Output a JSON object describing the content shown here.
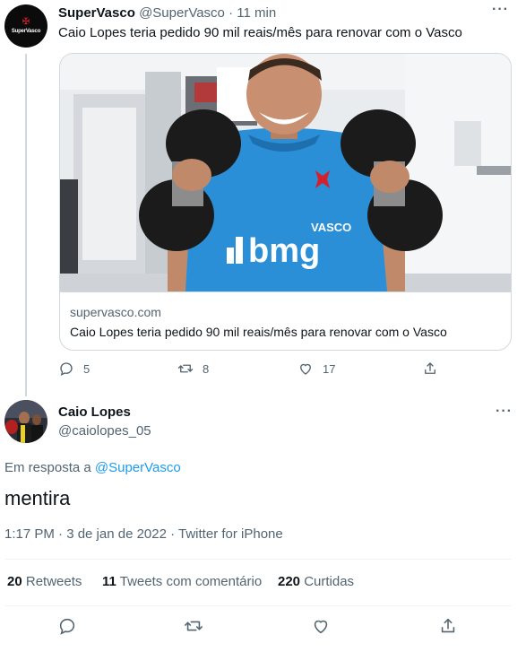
{
  "tweet1": {
    "avatar_text": "SuperVasco",
    "display_name": "SuperVasco",
    "handle": "@SuperVasco",
    "separator": "·",
    "time": "11 min",
    "text": "Caio Lopes teria pedido 90 mil reais/mês para renovar com o Vasco",
    "card": {
      "domain": "supervasco.com",
      "title": "Caio Lopes teria pedido 90 mil reais/mês para renovar com o Vasco",
      "image_text_club": "VASCO",
      "image_text_sponsor": "bmg"
    },
    "actions": {
      "replies": "5",
      "retweets": "8",
      "likes": "17"
    }
  },
  "tweet2": {
    "display_name": "Caio Lopes",
    "handle": "@caiolopes_05",
    "reply_prefix": "Em resposta a",
    "reply_to": "@SuperVasco",
    "text": "mentira",
    "meta": "1:17 PM · 3 de jan de 2022 · Twitter for iPhone",
    "stats": {
      "retweets_count": "20",
      "retweets_label": "Retweets",
      "quotes_count": "11",
      "quotes_label": "Tweets com comentário",
      "likes_count": "220",
      "likes_label": "Curtidas"
    }
  },
  "colors": {
    "text_primary": "#0f1419",
    "text_secondary": "#536471",
    "link": "#1d9bf0",
    "border": "#cfd9de",
    "jersey": "#2a8fd6"
  },
  "icons": [
    "more-icon",
    "reply-icon",
    "retweet-icon",
    "like-icon",
    "share-icon"
  ]
}
